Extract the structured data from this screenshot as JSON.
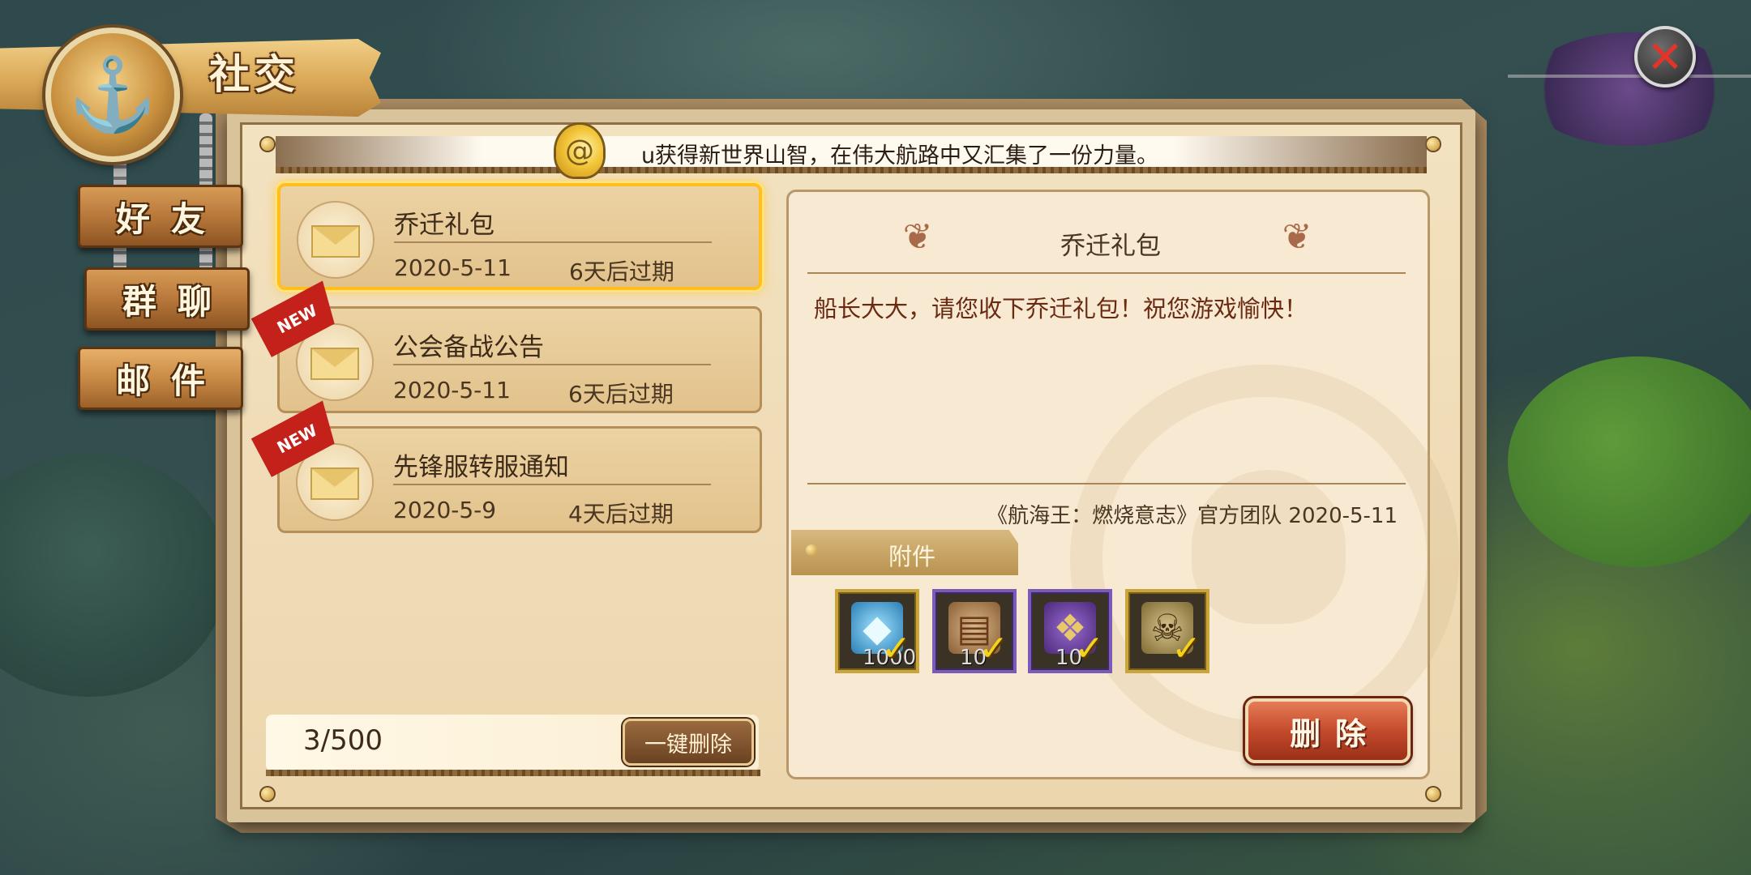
{
  "header": {
    "title": "社交",
    "icons": {
      "badge": "anchor-icon",
      "close": "close-icon"
    }
  },
  "nav": {
    "items": [
      {
        "label": "好友"
      },
      {
        "label": "群聊"
      },
      {
        "label": "邮件"
      }
    ],
    "active_index": 2
  },
  "ticker": {
    "text": "u获得新世界山智，在伟大航路中又汇集了一份力量。",
    "icon": "snail-icon"
  },
  "mail_list": {
    "items": [
      {
        "title": "乔迁礼包",
        "date": "2020-5-11",
        "expiry": "6天后过期",
        "new_badge": "",
        "selected": true
      },
      {
        "title": "公会备战公告",
        "date": "2020-5-11",
        "expiry": "6天后过期",
        "new_badge": "NEW",
        "selected": false
      },
      {
        "title": "先锋服转服通知",
        "date": "2020-5-9",
        "expiry": "4天后过期",
        "new_badge": "NEW",
        "selected": false
      }
    ],
    "count": "3/500",
    "delete_all_label": "一键删除"
  },
  "detail": {
    "title": "乔迁礼包",
    "body": "船长大大，请您收下乔迁礼包！祝您游戏愉快！",
    "signature": "《航海王：燃烧意志》官方团队 2020-5-11",
    "attachments_label": "附件",
    "attachments": [
      {
        "icon": "diamond-icon",
        "qty": "1000",
        "claimed": true,
        "rarity": "gold"
      },
      {
        "icon": "scroll-icon",
        "qty": "10",
        "claimed": true,
        "rarity": "purple"
      },
      {
        "icon": "pouch-icon",
        "qty": "10",
        "claimed": true,
        "rarity": "purple"
      },
      {
        "icon": "map-icon",
        "qty": "",
        "claimed": true,
        "rarity": "gold"
      }
    ],
    "delete_label": "删除"
  }
}
